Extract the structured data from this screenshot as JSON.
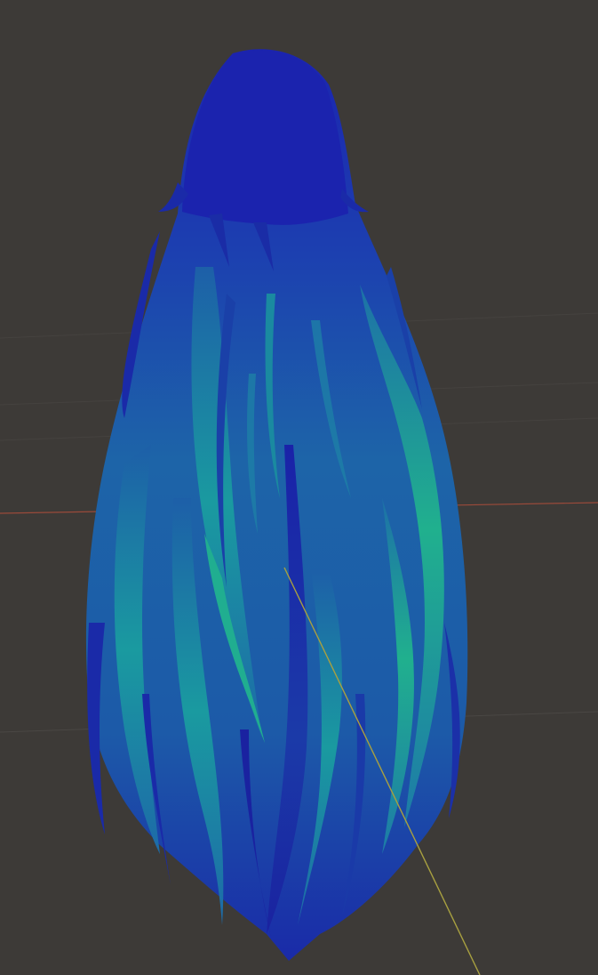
{
  "viewport": {
    "background": "#3d3a37",
    "model": "hair-mesh",
    "colors": {
      "strand_dark": "#1a22a8",
      "strand_mid": "#1d62a8",
      "strand_teal": "#1a9a98",
      "strand_green": "#22b58c",
      "axis_x": "#9a4a3a",
      "axis_y": "#a8a040",
      "grid_line": "#4a4744"
    },
    "grid": true,
    "axes_visible": [
      "x",
      "y"
    ]
  }
}
